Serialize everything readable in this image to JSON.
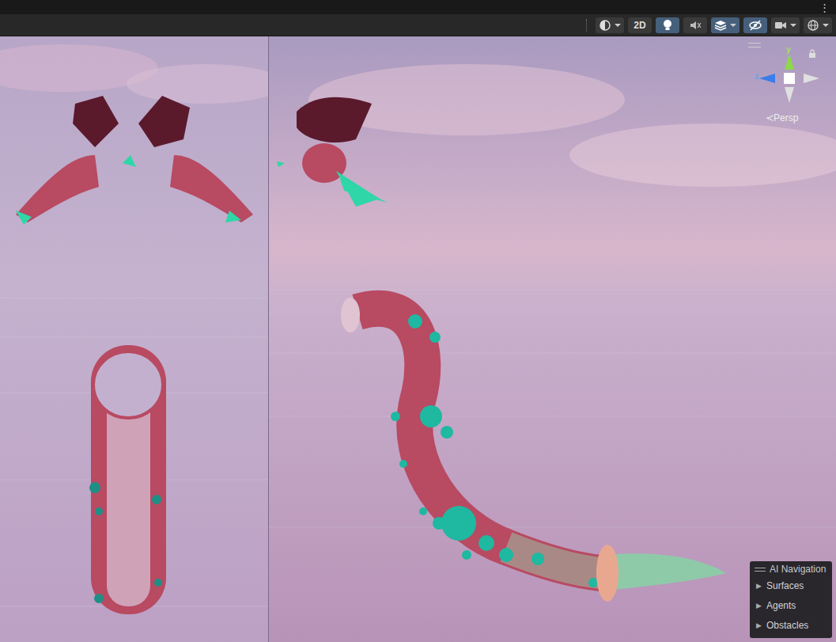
{
  "window": {
    "menu_icon": "⋮"
  },
  "toolbar": [
    {
      "kind": "shading",
      "label": "",
      "selected": false
    },
    {
      "kind": "2d",
      "label": "2D",
      "selected": false
    },
    {
      "kind": "lighting",
      "label": "",
      "selected": true
    },
    {
      "kind": "audio",
      "label": "",
      "selected": false
    },
    {
      "kind": "effects",
      "label": "",
      "selected": true
    },
    {
      "kind": "visibility",
      "label": "",
      "selected": true
    },
    {
      "kind": "camera",
      "label": "",
      "selected": false
    },
    {
      "kind": "gizmos",
      "label": "",
      "selected": false
    }
  ],
  "gizmo": {
    "axes": [
      "y",
      "z"
    ],
    "back_icon": "≺",
    "projection": "Persp"
  },
  "overlay": {
    "title": "AI Navigation",
    "items": [
      {
        "icon": "▶",
        "label": "Surfaces",
        "expanded": false
      },
      {
        "icon": "▶",
        "label": "Agents",
        "expanded": false
      },
      {
        "icon": "▶",
        "label": "Obstacles",
        "expanded": false
      }
    ]
  }
}
